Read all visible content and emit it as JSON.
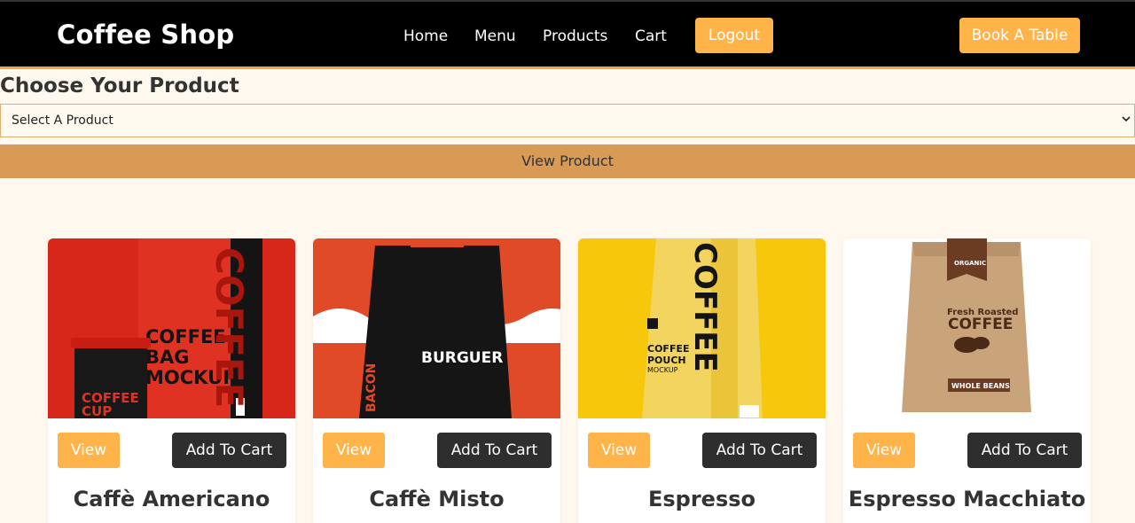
{
  "header": {
    "brand": "Coffee Shop",
    "nav": [
      "Home",
      "Menu",
      "Products",
      "Cart"
    ],
    "logout_label": "Logout",
    "book_label": "Book A Table"
  },
  "chooser": {
    "title": "Choose Your Product",
    "select_value": "Select A Product",
    "view_button": "View Product"
  },
  "products": [
    {
      "name": "Caffè Americano",
      "view_label": "View",
      "cart_label": "Add To Cart",
      "image_text": [
        "COFFEE",
        "BAG",
        "MOCKUP",
        "COFFEE",
        "CUP",
        "COFFEE"
      ]
    },
    {
      "name": "Caffè Misto",
      "view_label": "View",
      "cart_label": "Add To Cart",
      "image_text": [
        "BURGUER",
        "BACON"
      ]
    },
    {
      "name": "Espresso",
      "view_label": "View",
      "cart_label": "Add To Cart",
      "image_text": [
        "COFFEE",
        "POUCH",
        "MOCKUP",
        "COFFEE"
      ]
    },
    {
      "name": "Espresso Macchiato",
      "view_label": "View",
      "cart_label": "Add To Cart",
      "image_text": [
        "ORGANIC",
        "Fresh Roasted",
        "COFFEE",
        "WHOLE BEANS"
      ]
    }
  ],
  "colors": {
    "accent": "#ffb44a",
    "nav_bg": "#000000",
    "page_bg": "#fff8ee",
    "dark_button": "#2e2e2e",
    "view_product_bar": "#d99a55"
  }
}
